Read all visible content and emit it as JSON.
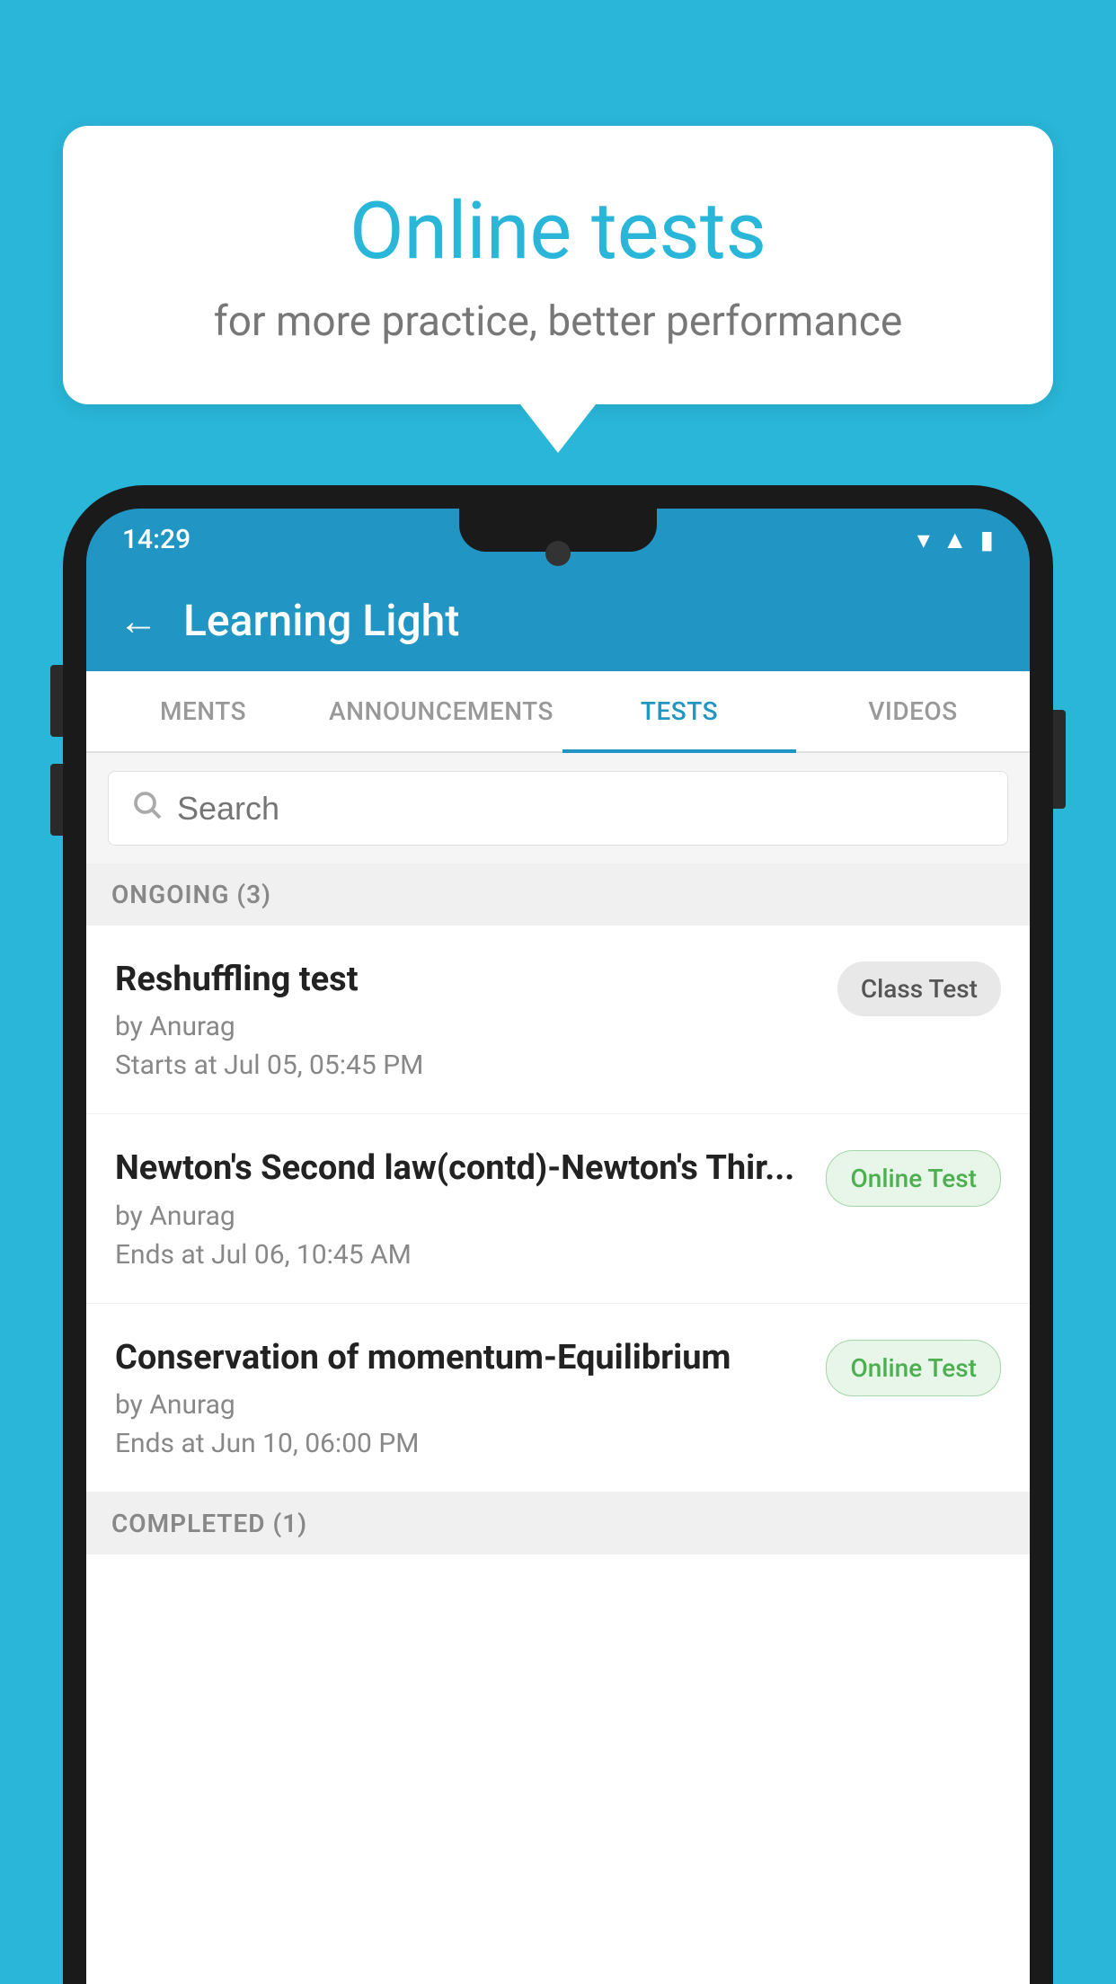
{
  "background_color": "#29b6d8",
  "speech_bubble": {
    "title": "Online tests",
    "subtitle": "for more practice, better performance"
  },
  "status_bar": {
    "time": "14:29",
    "icons": [
      "wifi",
      "signal",
      "battery"
    ]
  },
  "app_header": {
    "back_label": "←",
    "title": "Learning Light"
  },
  "tabs": [
    {
      "label": "MENTS",
      "active": false
    },
    {
      "label": "ANNOUNCEMENTS",
      "active": false
    },
    {
      "label": "TESTS",
      "active": true
    },
    {
      "label": "VIDEOS",
      "active": false
    }
  ],
  "search": {
    "placeholder": "Search"
  },
  "ongoing_section": {
    "label": "ONGOING (3)"
  },
  "tests": [
    {
      "name": "Reshuffling test",
      "by": "by Anurag",
      "date": "Starts at  Jul 05, 05:45 PM",
      "badge": "Class Test",
      "badge_type": "class"
    },
    {
      "name": "Newton's Second law(contd)-Newton's Thir...",
      "by": "by Anurag",
      "date": "Ends at  Jul 06, 10:45 AM",
      "badge": "Online Test",
      "badge_type": "online"
    },
    {
      "name": "Conservation of momentum-Equilibrium",
      "by": "by Anurag",
      "date": "Ends at  Jun 10, 06:00 PM",
      "badge": "Online Test",
      "badge_type": "online"
    }
  ],
  "completed_section": {
    "label": "COMPLETED (1)"
  }
}
